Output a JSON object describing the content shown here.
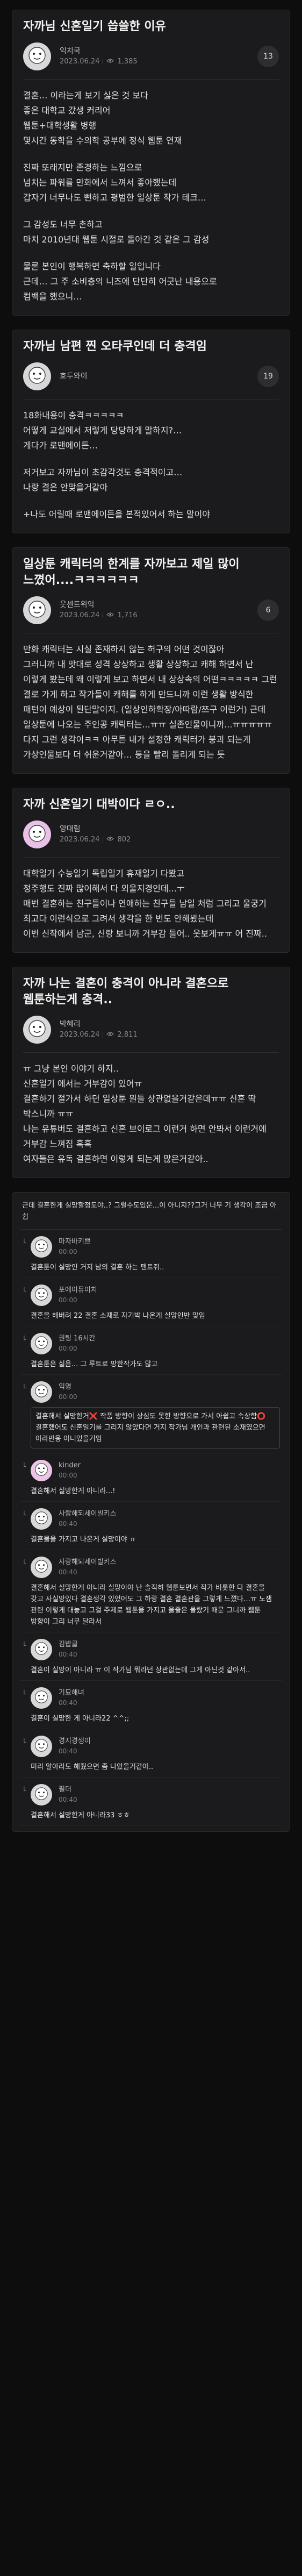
{
  "posts": [
    {
      "title": "자까님 신혼일기 씁쓸한 이유",
      "author": "익치국",
      "date": "2023.06.24",
      "views": "1,385",
      "comments": "13",
      "body": [
        "결혼… 이라는게 보기 싫은 것 보다",
        "좋은 대학교 갔생 커리어",
        "웹툰+대학생활 병행",
        "몇시간 동학을 수의학 공부에 정식 웹툰 연재",
        "",
        "진짜 또래지만 존경하는 느낌으로",
        "넘치는 파워를 만화에서 느껴서 좋아했는데",
        "갑자기 너무나도 뻔하고 평범한 일상툰 작가 테크…",
        "",
        "그 감성도 너무 촌하고",
        "마치 2010년대 웹툰 시절로 돌아간 것 같은 그 감성",
        "",
        "물론 본인이 행복하면 축하할 일입니다",
        "근데… 그 주 소비층의 니즈에 단단히 어긋난 내용으로",
        "컴백을 했으니…"
      ]
    },
    {
      "title": "자까님 남편 찐 오타쿠인데 더 충격임",
      "author": "호두와이",
      "date": "",
      "views": "",
      "comments": "19",
      "body": [
        "18화내용이 충격ㅋㅋㅋㅋㅋ",
        "어떻게 교실에서 저렇게 당당하게 말하지?…",
        "게다가 로맨에이든…",
        "",
        "저거보고 자까님이 초감각것도 충격적이고…",
        "나랑 결은 안맞을거같아",
        "",
        "+나도 어릴때 로맨에이든을 본적있어서 하는 말이야"
      ]
    },
    {
      "title": "일상툰 캐릭터의 한계를 자까보고 제일 많이 느꼈어....ㅋㅋㅋㅋㅋㅋ",
      "author": "웃센트위익",
      "date": "2023.06.24",
      "views": "1,716",
      "comments": "6",
      "body": [
        "만화 캐릭터는 시실 존재하지 않는 허구의 어떤 것이잖아",
        "그러니까 내 맛대로 성격 상상하고 생활 상상하고 캐해 하면서 난 이렇게 봤는데 왜 이렇게 보고 하면서 내 상상속의 어떤ㅋㅋㅋㅋㅋ 그런 결로 가게 하고 작가들이 캐해를 하게 만드니까 이런 생활 방식한 패턴이 예상이 된단말이지. (일상인하확장/아따람/쯔구 이런거) 근데 일상툰에 나오는 주인공 캐릭터는...ㅠㅠ 실존인물이니까...ㅠㅠㅠㅠㅠ 다지 그런 생각이ㅋㅋ 아무튼 내가 설정한 캐릭터가 붕괴 되는게 가상인물보다 더 쉬운거같아… 등을 빨리 돌리게 되는 듯"
      ]
    },
    {
      "title": "자까 신혼일기 대박이다 ㄹㅇ..",
      "author": "양대림",
      "date": "2023.06.24",
      "views": "802",
      "comments": "",
      "body": [
        "대학일기 수능일기 독립일기 휴재일기 다봤고",
        "정주행도 진짜 많이해서 다 외울지경인데...ㅜ",
        "매번 결혼하는 친구들이나 연애하는 친구들 남일 처럼 그리고 울궁기 최고다 이런식으로 그려서 생각을 한 번도 안해봤는데",
        "이번 신작에서 남군, 신랑 보니까 거부감 들어.. 웃보게ㅠㅠ 어 진짜.."
      ]
    },
    {
      "title": "자까 나는 결혼이 충격이 아니라 결혼으로 웹툰하는게 충격..",
      "author": "박혜리",
      "date": "2023.06.24",
      "views": "2,811",
      "comments": "",
      "body": [
        "ㅠ 그냥 본인 이야기 하지..",
        "신혼일기 에서는 거부감이 있어ㅠ",
        "결혼하기 절가서 하던 일상툰 뭔들 상관없을거같은데ㅠㅠ 신혼 딱 박스니까 ㅠㅠ",
        "나는 유튜버도 결혼하고 신혼 브이로그 이런거 하면 안봐서 이런거에 거부감 느껴짐 흑흑",
        "여자들은 유독 결혼하면 이렇게 되는게 많은거같아.."
      ]
    }
  ],
  "comment_section": {
    "top_text": "근데 결혼한게 실망할정도야..? 그럴수도있운...이 아니지??그거 너무 기 생각이 조금 아쉽",
    "replies": [
      {
        "name": "마자바키쁘",
        "time": "00:00",
        "text": "결혼툰이 실망인 거지 남의 결혼 하는 팬트쥐..",
        "highlight": false,
        "pink": false
      },
      {
        "name": "포에이듀이치",
        "time": "00:00",
        "text": "결혼을 해버려 22 결혼 소재로 자기박 나온게 실망인반 맞임",
        "highlight": false,
        "pink": false
      },
      {
        "name": "권팅 16시간",
        "time": "00:00",
        "text": "결혼툰은 싫음... 그 루트로 망한작가도 많고",
        "highlight": false,
        "pink": false
      },
      {
        "name": "익명",
        "time": "00:00",
        "text": "결혼해서 실망한거❌ 작품 방향이 상심도 못한 방향으로 가서 아쉽고 속상함⭕ 결혼했어도 신혼일기를 그리지 않았다면 거지 작가님 개인과 관련된 소재였으면 아라반응 아니었을거임",
        "highlight": true,
        "pink": false
      },
      {
        "name": "kinder",
        "time": "00:00",
        "text": "결혼해서 실망한게 아니라...!",
        "highlight": false,
        "pink": true
      },
      {
        "name": "사랑해되세이빌키스",
        "time": "00:40",
        "text": "결혼물을 가지고 나온게 실망이야 ㅠ",
        "highlight": false,
        "pink": false
      },
      {
        "name": "사랑해되세이빌키스",
        "time": "00:40",
        "text": "결혼해서 실망한게 아니라 실망이야 난 솔직히 웹툰보면서 작가 비롯한 다 결혼을 갖고 사실망있다 결혼생각 있었어도 그 하랑 결혼 결혼관을 그렇게 느꼈다…ㅠ 노잼 관련 이렇게 대놓고 그걸 주제로 웹툰을 가지고 올줄은 몰랐기 때문 그니까 웹툰 방향이 그리 너무 달라서",
        "highlight": false,
        "pink": false
      },
      {
        "name": "김밥글",
        "time": "00:40",
        "text": "결혼이 실망이 아니라 ㅠ 이 작가님 뭐라던 상관없는데 그게 아닌것 같아서..",
        "highlight": false,
        "pink": false
      },
      {
        "name": "기묘해녀",
        "time": "00:40",
        "text": "결혼이 실망한 게 아니라22 ^^;;",
        "highlight": false,
        "pink": false
      },
      {
        "name": "경지경생이",
        "time": "00:40",
        "text": "미리 알아라도 해줬으면 좀 나았을거같아..",
        "highlight": false,
        "pink": false
      },
      {
        "name": "필더",
        "time": "00:40",
        "text": "결혼해서 실망한게 아니라33 ㅎㅎ",
        "highlight": false,
        "pink": false
      }
    ]
  }
}
